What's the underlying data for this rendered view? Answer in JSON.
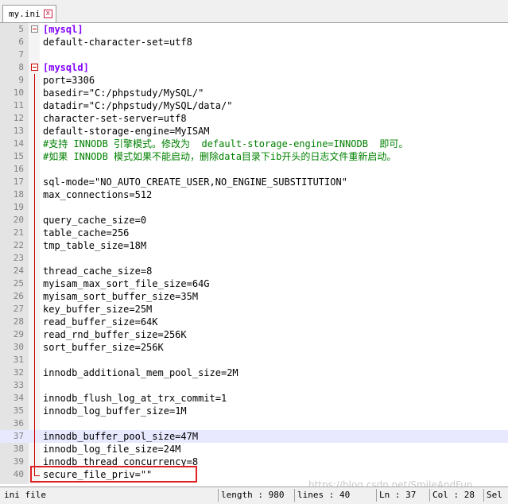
{
  "tab": {
    "title": "my.ini",
    "close_glyph": "x"
  },
  "lines": [
    {
      "num": "5",
      "key": "[mysql]",
      "type": "section",
      "fold": "open"
    },
    {
      "num": "6",
      "key": "default-character-set",
      "val": "utf8"
    },
    {
      "num": "7"
    },
    {
      "num": "8",
      "key": "[mysqld]",
      "type": "section",
      "fold": "open-red"
    },
    {
      "num": "9",
      "key": "port",
      "val": "3306"
    },
    {
      "num": "10",
      "key": "basedir",
      "val": "\"C:/phpstudy/MySQL/\""
    },
    {
      "num": "11",
      "key": "datadir",
      "val": "\"C:/phpstudy/MySQL/data/\""
    },
    {
      "num": "12",
      "key": "character-set-server",
      "val": "utf8"
    },
    {
      "num": "13",
      "key": "default-storage-engine",
      "val": "MyISAM"
    },
    {
      "num": "14",
      "comment": "#支持 INNODB 引擎模式。修改为  default-storage-engine=INNODB  即可。"
    },
    {
      "num": "15",
      "comment": "#如果 INNODB 模式如果不能启动，删除data目录下ib开头的日志文件重新启动。"
    },
    {
      "num": "16"
    },
    {
      "num": "17",
      "key": "sql-mode",
      "val": "\"NO_AUTO_CREATE_USER,NO_ENGINE_SUBSTITUTION\""
    },
    {
      "num": "18",
      "key": "max_connections",
      "val": "512"
    },
    {
      "num": "19"
    },
    {
      "num": "20",
      "key": "query_cache_size",
      "val": "0"
    },
    {
      "num": "21",
      "key": "table_cache",
      "val": "256"
    },
    {
      "num": "22",
      "key": "tmp_table_size",
      "val": "18M"
    },
    {
      "num": "23"
    },
    {
      "num": "24",
      "key": "thread_cache_size",
      "val": "8"
    },
    {
      "num": "25",
      "key": "myisam_max_sort_file_size",
      "val": "64G"
    },
    {
      "num": "26",
      "key": "myisam_sort_buffer_size",
      "val": "35M"
    },
    {
      "num": "27",
      "key": "key_buffer_size",
      "val": "25M"
    },
    {
      "num": "28",
      "key": "read_buffer_size",
      "val": "64K"
    },
    {
      "num": "29",
      "key": "read_rnd_buffer_size",
      "val": "256K"
    },
    {
      "num": "30",
      "key": "sort_buffer_size",
      "val": "256K"
    },
    {
      "num": "31"
    },
    {
      "num": "32",
      "key": "innodb_additional_mem_pool_size",
      "val": "2M"
    },
    {
      "num": "33"
    },
    {
      "num": "34",
      "key": "innodb_flush_log_at_trx_commit",
      "val": "1"
    },
    {
      "num": "35",
      "key": "innodb_log_buffer_size",
      "val": "1M"
    },
    {
      "num": "36"
    },
    {
      "num": "37",
      "key": "innodb_buffer_pool_size",
      "val": "47M",
      "highlight": true
    },
    {
      "num": "38",
      "key": "innodb_log_file_size",
      "val": "24M"
    },
    {
      "num": "39",
      "key": "innodb_thread_concurrency",
      "val": "8"
    },
    {
      "num": "40",
      "key": "secure_file_priv",
      "val": "\"\"",
      "fold": "end"
    }
  ],
  "status": {
    "filetype": "ini file",
    "length": "length : 980",
    "lines": "lines : 40",
    "ln": "Ln : 37",
    "col": "Col : 28",
    "sel": "Sel"
  },
  "watermark": "https://blog.csdn.net/SmileAndFun"
}
